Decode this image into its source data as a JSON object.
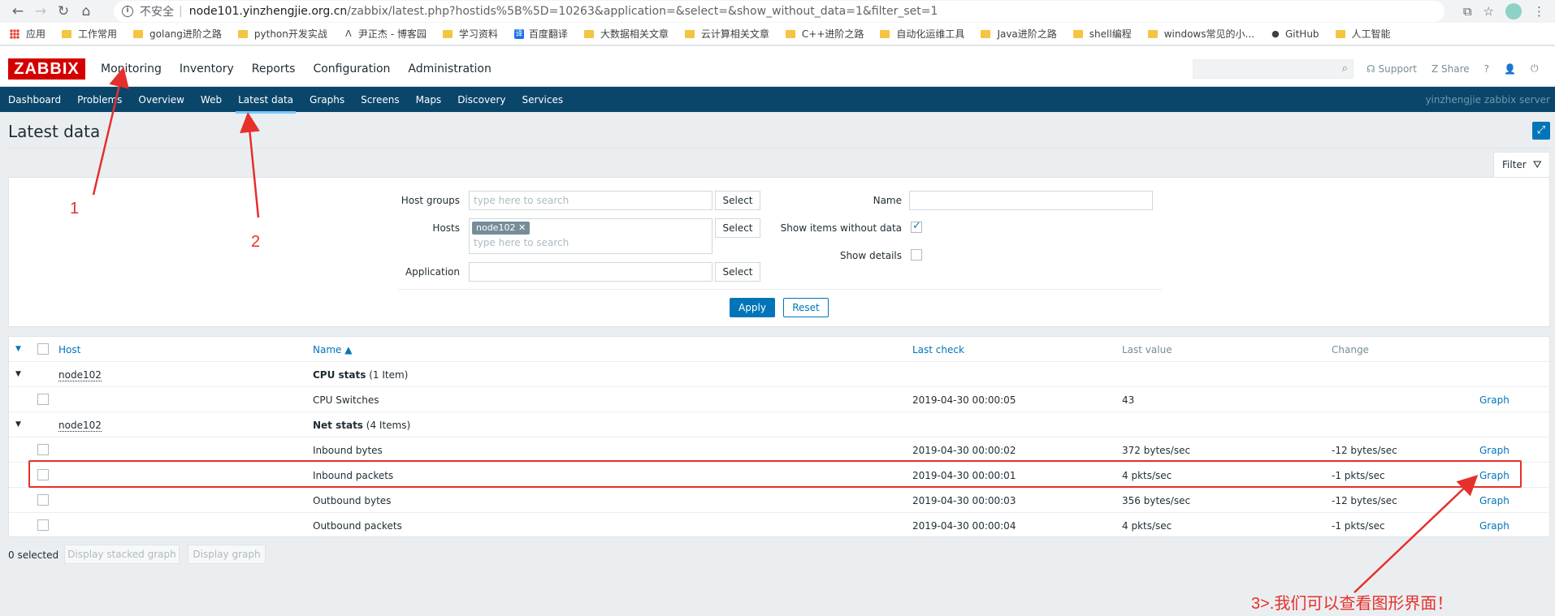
{
  "browser": {
    "insecure_label": "不安全",
    "url_host": "node101.yinzhengjie.org.cn",
    "url_path": "/zabbix/latest.php?hostids%5B%5D=10263&application=&select=&show_without_data=1&filter_set=1",
    "bookmarks": [
      {
        "label": "应用",
        "icon": "apps-icon"
      },
      {
        "label": "工作常用",
        "icon": "folder-icon"
      },
      {
        "label": "golang进阶之路",
        "icon": "folder-icon"
      },
      {
        "label": "python开发实战",
        "icon": "folder-icon"
      },
      {
        "label": "尹正杰 - 博客园",
        "icon": "blog-icon"
      },
      {
        "label": "学习资料",
        "icon": "folder-icon"
      },
      {
        "label": "百度翻译",
        "icon": "translate-icon"
      },
      {
        "label": "大数据相关文章",
        "icon": "folder-icon"
      },
      {
        "label": "云计算相关文章",
        "icon": "folder-icon"
      },
      {
        "label": "C++进阶之路",
        "icon": "folder-icon"
      },
      {
        "label": "自动化运维工具",
        "icon": "folder-icon"
      },
      {
        "label": "Java进阶之路",
        "icon": "folder-icon"
      },
      {
        "label": "shell编程",
        "icon": "folder-icon"
      },
      {
        "label": "windows常见的小...",
        "icon": "folder-icon"
      },
      {
        "label": "GitHub",
        "icon": "github-icon"
      },
      {
        "label": "人工智能",
        "icon": "folder-icon"
      }
    ]
  },
  "header": {
    "logo": "ZABBIX",
    "menu": [
      "Monitoring",
      "Inventory",
      "Reports",
      "Configuration",
      "Administration"
    ],
    "support": "Support",
    "share": "Share",
    "help": "?"
  },
  "subnav": {
    "items": [
      "Dashboard",
      "Problems",
      "Overview",
      "Web",
      "Latest data",
      "Graphs",
      "Screens",
      "Maps",
      "Discovery",
      "Services"
    ],
    "active": "Latest data",
    "server_name": "yinzhengjie zabbix server"
  },
  "page": {
    "title": "Latest data",
    "filter_tab": "Filter"
  },
  "filter": {
    "host_groups_label": "Host groups",
    "hosts_label": "Hosts",
    "application_label": "Application",
    "name_label": "Name",
    "show_without_data_label": "Show items without data",
    "show_details_label": "Show details",
    "placeholder": "type here to search",
    "select_label": "Select",
    "host_chip": "node102",
    "apply": "Apply",
    "reset": "Reset"
  },
  "table": {
    "headers": {
      "host": "Host",
      "name": "Name ▲",
      "last_check": "Last check",
      "last_value": "Last value",
      "change": "Change"
    },
    "groups": [
      {
        "host": "node102",
        "name": "CPU stats",
        "count": "(1 Item)"
      },
      {
        "host": "node102",
        "name": "Net stats",
        "count": "(4 Items)"
      }
    ],
    "rows": [
      {
        "name": "CPU Switches",
        "last_check": "2019-04-30 00:00:05",
        "last_value": "43",
        "change": "",
        "graph": "Graph"
      },
      {
        "name": "Inbound bytes",
        "last_check": "2019-04-30 00:00:02",
        "last_value": "372 bytes/sec",
        "change": "-12 bytes/sec",
        "graph": "Graph"
      },
      {
        "name": "Inbound packets",
        "last_check": "2019-04-30 00:00:01",
        "last_value": "4 pkts/sec",
        "change": "-1 pkts/sec",
        "graph": "Graph"
      },
      {
        "name": "Outbound bytes",
        "last_check": "2019-04-30 00:00:03",
        "last_value": "356 bytes/sec",
        "change": "-12 bytes/sec",
        "graph": "Graph"
      },
      {
        "name": "Outbound packets",
        "last_check": "2019-04-30 00:00:04",
        "last_value": "4 pkts/sec",
        "change": "-1 pkts/sec",
        "graph": "Graph"
      }
    ]
  },
  "footer": {
    "selected": "0 selected",
    "stacked_graph": "Display stacked graph",
    "graph": "Display graph"
  },
  "annotations": {
    "one": "1",
    "two": "2",
    "three": "3>.我们可以查看图形界面！",
    "color": "#e5302c"
  }
}
